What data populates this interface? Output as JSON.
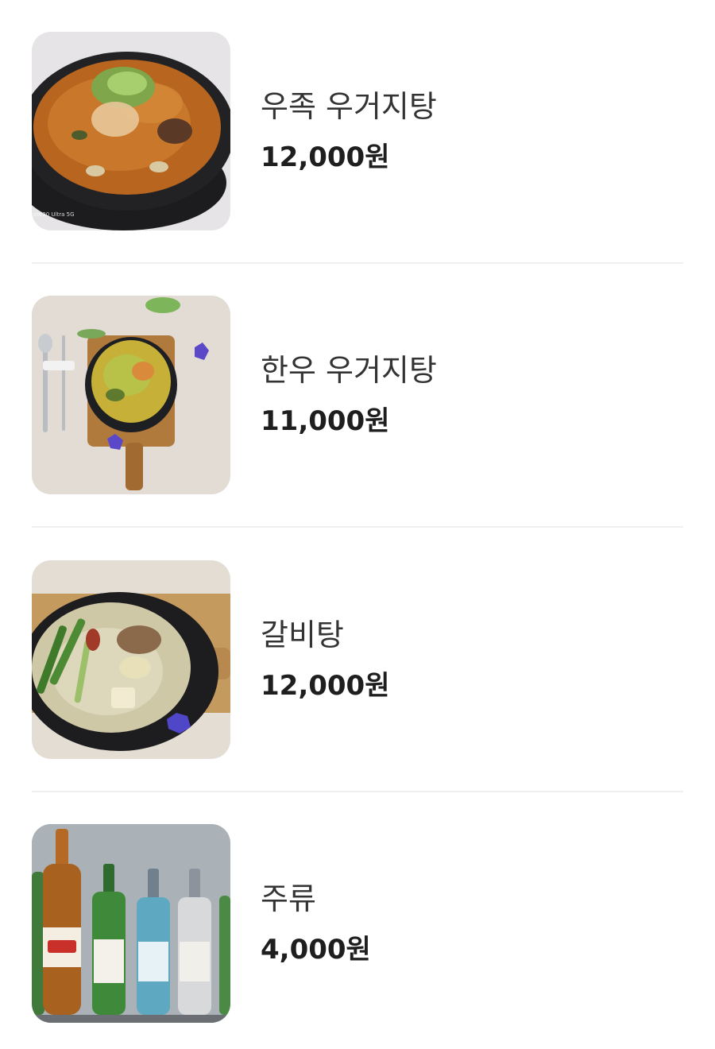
{
  "menu": {
    "items": [
      {
        "name": "우족 우거지탕",
        "price": "12,000원",
        "image": "ujok-ugeoji-tang-photo",
        "photo_watermark": "ote20 Ultra 5G"
      },
      {
        "name": "한우 우거지탕",
        "price": "11,000원",
        "image": "hanwoo-ugeoji-tang-photo"
      },
      {
        "name": "갈비탕",
        "price": "12,000원",
        "image": "galbi-tang-photo"
      },
      {
        "name": "주류",
        "price": "4,000원",
        "image": "liquor-bottles-photo"
      }
    ]
  },
  "colors": {
    "divider": "#f0f0f0",
    "name_text": "#333333",
    "price_text": "#1e1e1e"
  }
}
